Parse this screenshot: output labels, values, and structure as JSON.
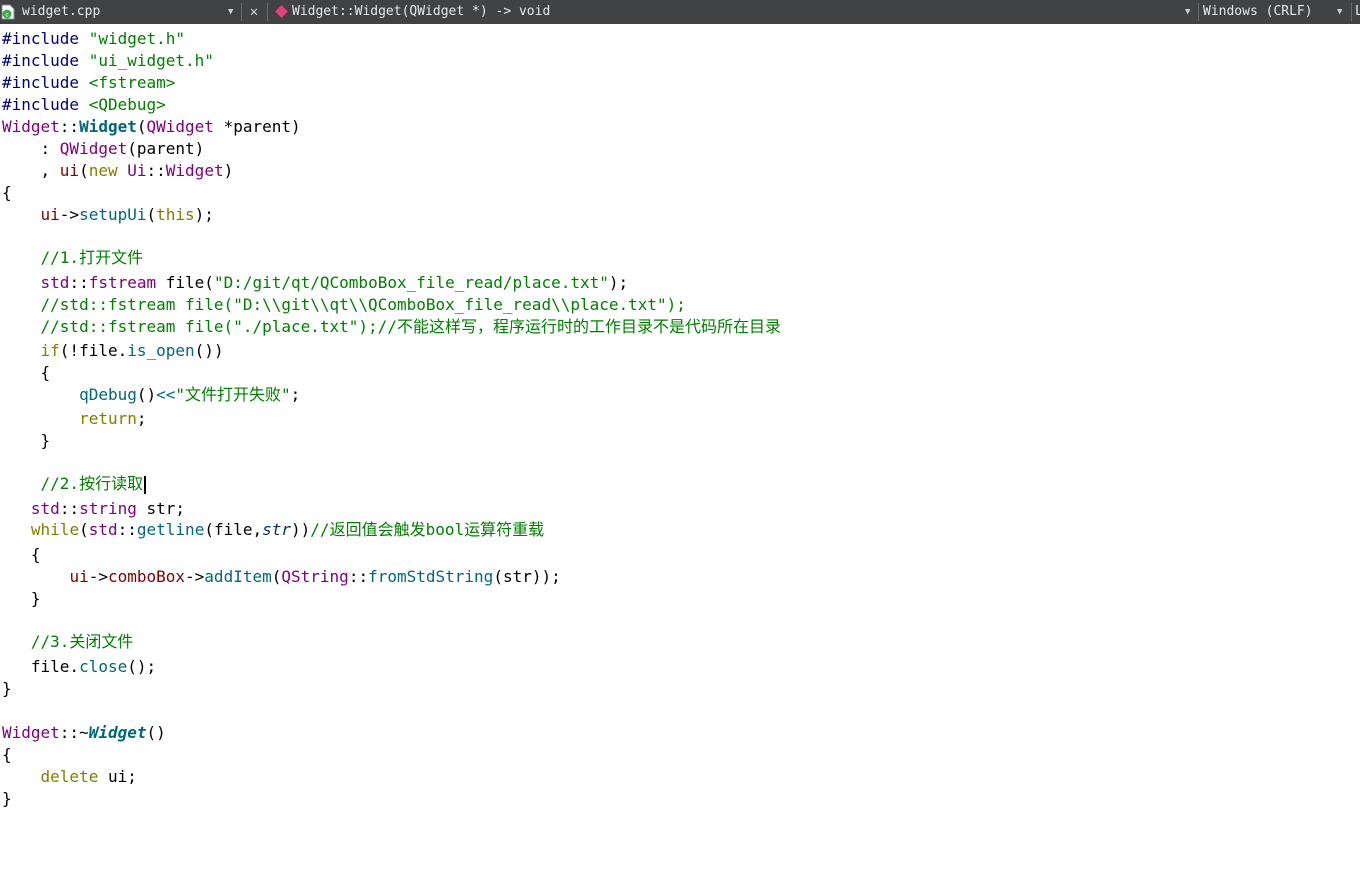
{
  "toolbar": {
    "file_name": "widget.cpp",
    "file_icon": "cpp-file-icon",
    "close_icon": "close-icon",
    "symbol_icon": "function-symbol-icon",
    "symbol": "Widget::Widget(QWidget *) -> void",
    "encoding": "Windows (CRLF)",
    "extra": "L"
  },
  "colors": {
    "keyword": "#808000",
    "string": "#008000",
    "comment": "#008000",
    "type": "#800080",
    "function": "#00677c",
    "toolbar_bg": "#404244"
  },
  "editor": {
    "code": {
      "l1a": "#include",
      "l1b": "\"widget.h\"",
      "l2a": "#include",
      "l2b": "\"ui_widget.h\"",
      "l3a": "#include",
      "l3b": "<fstream>",
      "l4a": "#include",
      "l4b": "<QDebug>",
      "l5a": "Widget",
      "l5b": "::",
      "l5c": "Widget",
      "l5d": "(",
      "l5e": "QWidget",
      "l5f": " *parent)",
      "l6a": "    : ",
      "l6b": "QWidget",
      "l6c": "(parent)",
      "l7a": "    , ",
      "l7b": "ui",
      "l7c": "(",
      "l7d": "new",
      "l7e": " ",
      "l7f": "Ui",
      "l7g": "::",
      "l7h": "Widget",
      "l7i": ")",
      "l8": "{",
      "l9a": "    ",
      "l9b": "ui",
      "l9c": "->",
      "l9d": "setupUi",
      "l9e": "(",
      "l9f": "this",
      "l9g": ");",
      "l10": "    //1.打开文件",
      "l11a": "    ",
      "l11b": "std",
      "l11c": "::",
      "l11d": "fstream",
      "l11e": " file(",
      "l11f": "\"D:/git/qt/QComboBox_file_read/place.txt\"",
      "l11g": ");",
      "l12": "    //std::fstream file(\"D:\\\\git\\\\qt\\\\QComboBox_file_read\\\\place.txt\");",
      "l13": "    //std::fstream file(\"./place.txt\");//不能这样写，程序运行时的工作目录不是代码所在目录",
      "l14a": "    ",
      "l14b": "if",
      "l14c": "(!file.",
      "l14d": "is_open",
      "l14e": "())",
      "l15": "    {",
      "l16a": "        ",
      "l16b": "qDebug",
      "l16c": "()",
      "l16d": "<<",
      "l16e": "\"文件打开失败\"",
      "l16f": ";",
      "l17a": "        ",
      "l17b": "return",
      "l17c": ";",
      "l18": "    }",
      "l19": "    //2.按行读取",
      "l20a": "   ",
      "l20b": "std",
      "l20c": "::",
      "l20d": "string",
      "l20e": " str;",
      "l21a": "   ",
      "l21b": "while",
      "l21c": "(",
      "l21d": "std",
      "l21e": "::",
      "l21f": "getline",
      "l21g": "(file,",
      "l21h": "str",
      "l21i": "))",
      "l21j": "//返回值会触发bool运算符重载",
      "l22": "   {",
      "l23a": "       ",
      "l23b": "ui",
      "l23c": "->",
      "l23d": "comboBox",
      "l23e": "->",
      "l23f": "addItem",
      "l23g": "(",
      "l23h": "QString",
      "l23i": "::",
      "l23j": "fromStdString",
      "l23k": "(str));",
      "l24": "   }",
      "l25": "   //3.关闭文件",
      "l26a": "   file.",
      "l26b": "close",
      "l26c": "();",
      "l27": "}",
      "l28a": "Widget",
      "l28b": "::~",
      "l28c": "Widget",
      "l28d": "()",
      "l29": "{",
      "l30a": "    ",
      "l30b": "delete",
      "l30c": " ui;",
      "l31": "}"
    }
  }
}
